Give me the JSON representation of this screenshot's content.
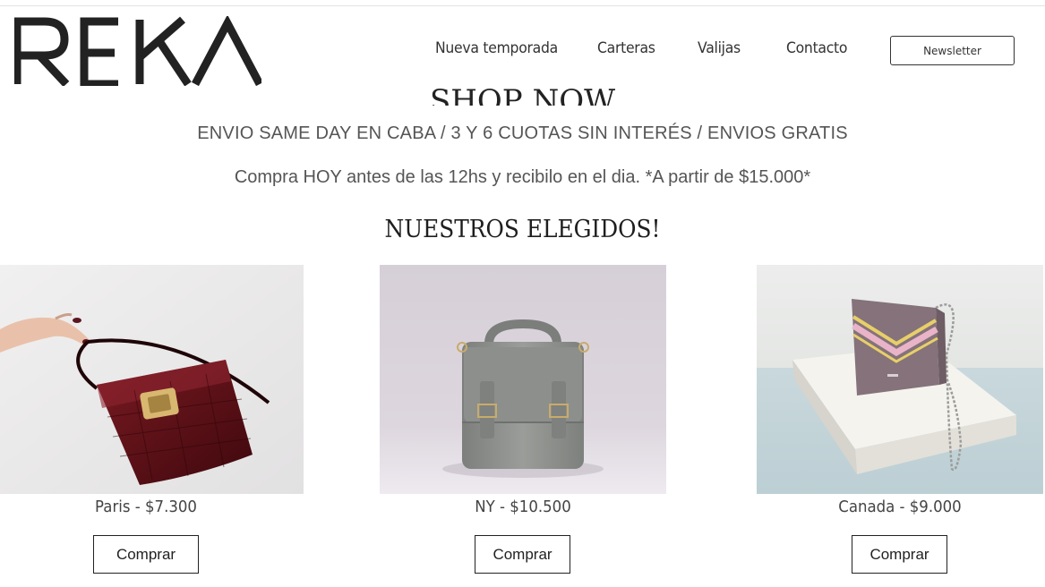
{
  "brand": {
    "logo_text": "REKA"
  },
  "nav": {
    "items": [
      {
        "label": "Nueva temporada"
      },
      {
        "label": "Carteras"
      },
      {
        "label": "Valijas"
      },
      {
        "label": "Contacto"
      }
    ],
    "newsletter_label": "Newsletter"
  },
  "hero": {
    "shop_now": "SHOP NOW",
    "promo_line_1": "ENVIO SAME DAY EN CABA / 3 Y 6 CUOTAS SIN INTERÉS / ENVIOS GRATIS",
    "promo_line_2": "Compra HOY antes de las 12hs y recibilo en el dia. *A partir de $15.000*"
  },
  "featured": {
    "title": "NUESTROS ELEGIDOS!",
    "products": [
      {
        "name": "Paris - $7.300",
        "button": "Comprar"
      },
      {
        "name": "NY - $10.500",
        "button": "Comprar"
      },
      {
        "name": "Canada - $9.000",
        "button": "Comprar"
      }
    ]
  },
  "colors": {
    "text": "#222222",
    "muted": "#555555",
    "paris_bag": "#5e1018",
    "ny_bag": "#8d908c",
    "canada_bag": "#85727a"
  }
}
